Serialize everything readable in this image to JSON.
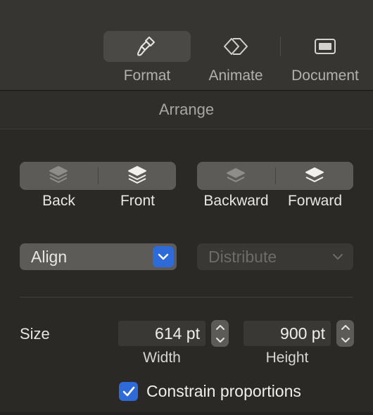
{
  "toolbar": {
    "format_label": "Format",
    "animate_label": "Animate",
    "document_label": "Document",
    "active_tab": "Format"
  },
  "section": {
    "title": "Arrange"
  },
  "arrange": {
    "back_label": "Back",
    "front_label": "Front",
    "backward_label": "Backward",
    "forward_label": "Forward"
  },
  "align": {
    "value": "Align"
  },
  "distribute": {
    "value": "Distribute",
    "enabled": false
  },
  "size": {
    "label": "Size",
    "width_value": "614 pt",
    "height_value": "900 pt",
    "width_caption": "Width",
    "height_caption": "Height"
  },
  "constrain": {
    "label": "Constrain proportions",
    "checked": true
  },
  "colors": {
    "accent": "#2e6ad8",
    "background": "#2a2926",
    "toolbar": "#363532"
  }
}
